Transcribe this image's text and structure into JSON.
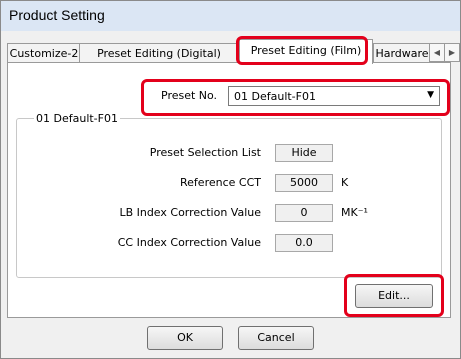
{
  "window": {
    "title": "Product Setting"
  },
  "tabs": [
    {
      "label": "Customize-2"
    },
    {
      "label": "Preset Editing (Digital)"
    },
    {
      "label": "Preset Editing (Film)"
    },
    {
      "label": "Hardware"
    }
  ],
  "tab_arrows": {
    "left_icon": "◀",
    "right_icon": "▶"
  },
  "preset": {
    "label": "Preset No.",
    "selected": "01 Default-F01",
    "arrow_icon": "▼"
  },
  "group": {
    "title": "01 Default-F01",
    "rows": [
      {
        "label": "Preset Selection List",
        "value": "Hide",
        "unit": ""
      },
      {
        "label": "Reference CCT",
        "value": "5000",
        "unit": "K"
      },
      {
        "label": "LB Index Correction Value",
        "value": "0",
        "unit": "MK⁻¹"
      },
      {
        "label": "CC Index Correction Value",
        "value": "0.0",
        "unit": ""
      }
    ]
  },
  "buttons": {
    "edit": "Edit...",
    "ok": "OK",
    "cancel": "Cancel"
  },
  "highlight_color": "#e3001b"
}
